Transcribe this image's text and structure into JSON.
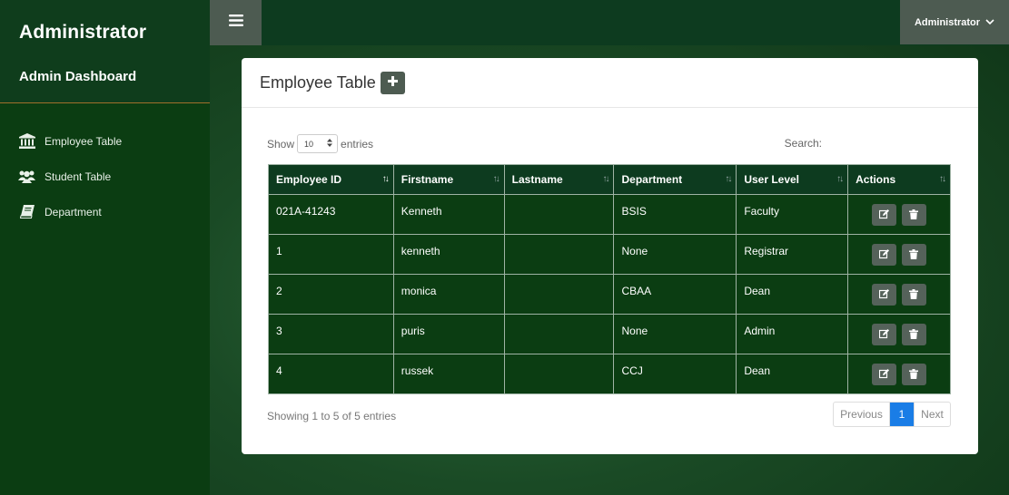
{
  "sidebar": {
    "brand": "Administrator",
    "subtitle": "Admin Dashboard",
    "items": [
      {
        "label": "Employee Table",
        "icon": "bank-icon"
      },
      {
        "label": "Student Table",
        "icon": "users-icon"
      },
      {
        "label": "Department",
        "icon": "book-icon"
      }
    ]
  },
  "topbar": {
    "menu_icon": "hamburger-icon",
    "user_label": "Administrator"
  },
  "card": {
    "title": "Employee Table",
    "add_icon": "plus-icon",
    "show_label": "Show",
    "entries_label": "entries",
    "page_size": "10",
    "search_label": "Search:",
    "info": "Showing 1 to 5 of 5 entries",
    "pagination": {
      "previous": "Previous",
      "current": "1",
      "next": "Next"
    }
  },
  "table": {
    "columns": [
      "Employee ID",
      "Firstname",
      "Lastname",
      "Department",
      "User Level",
      "Actions"
    ],
    "rows": [
      {
        "id": "021A-41243",
        "firstname": "Kenneth",
        "lastname": "",
        "department": "BSIS",
        "level": "Faculty"
      },
      {
        "id": "1",
        "firstname": "kenneth",
        "lastname": "",
        "department": "None",
        "level": "Registrar"
      },
      {
        "id": "2",
        "firstname": "monica",
        "lastname": "",
        "department": "CBAA",
        "level": "Dean"
      },
      {
        "id": "3",
        "firstname": "puris",
        "lastname": "",
        "department": "None",
        "level": "Admin"
      },
      {
        "id": "4",
        "firstname": "russek",
        "lastname": "",
        "department": "CCJ",
        "level": "Dean"
      }
    ]
  },
  "colors": {
    "sidebar": "#0b3d12",
    "topbar": "#0d3b1f",
    "button": "#4d5b51",
    "accent": "#1a7de6"
  }
}
